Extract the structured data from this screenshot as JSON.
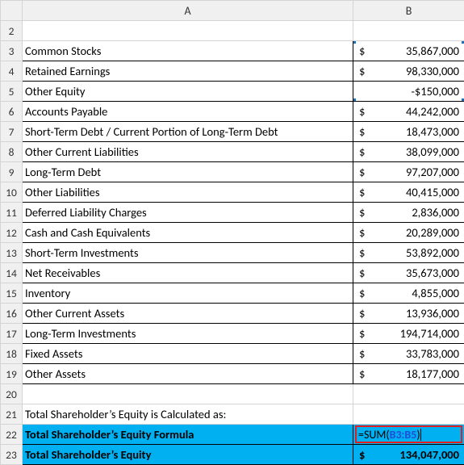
{
  "columns": {
    "A": "A",
    "B": "B"
  },
  "rows": [
    {
      "n": 2,
      "label": "",
      "b_type": "empty"
    },
    {
      "n": 3,
      "label": "Common Stocks",
      "b_type": "money",
      "cur": "$",
      "val": "35,867,000"
    },
    {
      "n": 4,
      "label": "Retained Earnings",
      "b_type": "money",
      "cur": "$",
      "val": "98,330,000"
    },
    {
      "n": 5,
      "label": "Other Equity",
      "b_type": "neg",
      "val": "-$150,000"
    },
    {
      "n": 6,
      "label": "Accounts Payable",
      "b_type": "money",
      "cur": "$",
      "val": "44,242,000"
    },
    {
      "n": 7,
      "label": "Short-Term Debt / Current Portion of Long-Term Debt",
      "b_type": "money",
      "cur": "$",
      "val": "18,473,000"
    },
    {
      "n": 8,
      "label": "Other Current Liabilities",
      "b_type": "money",
      "cur": "$",
      "val": "38,099,000"
    },
    {
      "n": 9,
      "label": "Long-Term Debt",
      "b_type": "money",
      "cur": "$",
      "val": "97,207,000"
    },
    {
      "n": 10,
      "label": "Other Liabilities",
      "b_type": "money",
      "cur": "$",
      "val": "40,415,000"
    },
    {
      "n": 11,
      "label": "Deferred Liability Charges",
      "b_type": "money",
      "cur": "$",
      "val": "2,836,000"
    },
    {
      "n": 12,
      "label": "Cash and Cash Equivalents",
      "b_type": "money",
      "cur": "$",
      "val": "20,289,000"
    },
    {
      "n": 13,
      "label": "Short-Term Investments",
      "b_type": "money",
      "cur": "$",
      "val": "53,892,000"
    },
    {
      "n": 14,
      "label": "Net Receivables",
      "b_type": "money",
      "cur": "$",
      "val": "35,673,000"
    },
    {
      "n": 15,
      "label": "Inventory",
      "b_type": "money",
      "cur": "$",
      "val": "4,855,000"
    },
    {
      "n": 16,
      "label": "Other Current Assets",
      "b_type": "money",
      "cur": "$",
      "val": "13,936,000"
    },
    {
      "n": 17,
      "label": "Long-Term Investments",
      "b_type": "money",
      "cur": "$",
      "val": "194,714,000"
    },
    {
      "n": 18,
      "label": "Fixed Assets",
      "b_type": "money",
      "cur": "$",
      "val": "33,783,000"
    },
    {
      "n": 19,
      "label": "Other Assets",
      "b_type": "money",
      "cur": "$",
      "val": "18,177,000"
    }
  ],
  "row20": {
    "n": 20
  },
  "row21": {
    "n": 21,
    "text": "Total Shareholder’s Equity is Calculated as:"
  },
  "row22": {
    "n": 22,
    "label": "Total Shareholder’s Equity Formula",
    "formula_prefix": "=SUM(",
    "formula_ref": "B3:B5",
    "formula_suffix": ")"
  },
  "row23": {
    "n": 23,
    "label": "Total Shareholder’s Equity",
    "cur": "$",
    "val": "134,047,000"
  },
  "chart_data": {
    "type": "table",
    "title": "Balance Sheet Line Items and Shareholder’s Equity Calculation",
    "items": [
      {
        "label": "Common Stocks",
        "value": 35867000
      },
      {
        "label": "Retained Earnings",
        "value": 98330000
      },
      {
        "label": "Other Equity",
        "value": -150000
      },
      {
        "label": "Accounts Payable",
        "value": 44242000
      },
      {
        "label": "Short-Term Debt / Current Portion of Long-Term Debt",
        "value": 18473000
      },
      {
        "label": "Other Current Liabilities",
        "value": 38099000
      },
      {
        "label": "Long-Term Debt",
        "value": 97207000
      },
      {
        "label": "Other Liabilities",
        "value": 40415000
      },
      {
        "label": "Deferred Liability Charges",
        "value": 2836000
      },
      {
        "label": "Cash and Cash Equivalents",
        "value": 20289000
      },
      {
        "label": "Short-Term Investments",
        "value": 53892000
      },
      {
        "label": "Net Receivables",
        "value": 35673000
      },
      {
        "label": "Inventory",
        "value": 4855000
      },
      {
        "label": "Other Current Assets",
        "value": 13936000
      },
      {
        "label": "Long-Term Investments",
        "value": 194714000
      },
      {
        "label": "Fixed Assets",
        "value": 33783000
      },
      {
        "label": "Other Assets",
        "value": 18177000
      }
    ],
    "calculation": {
      "label": "Total Shareholder’s Equity",
      "formula": "=SUM(B3:B5)",
      "result": 134047000
    }
  }
}
